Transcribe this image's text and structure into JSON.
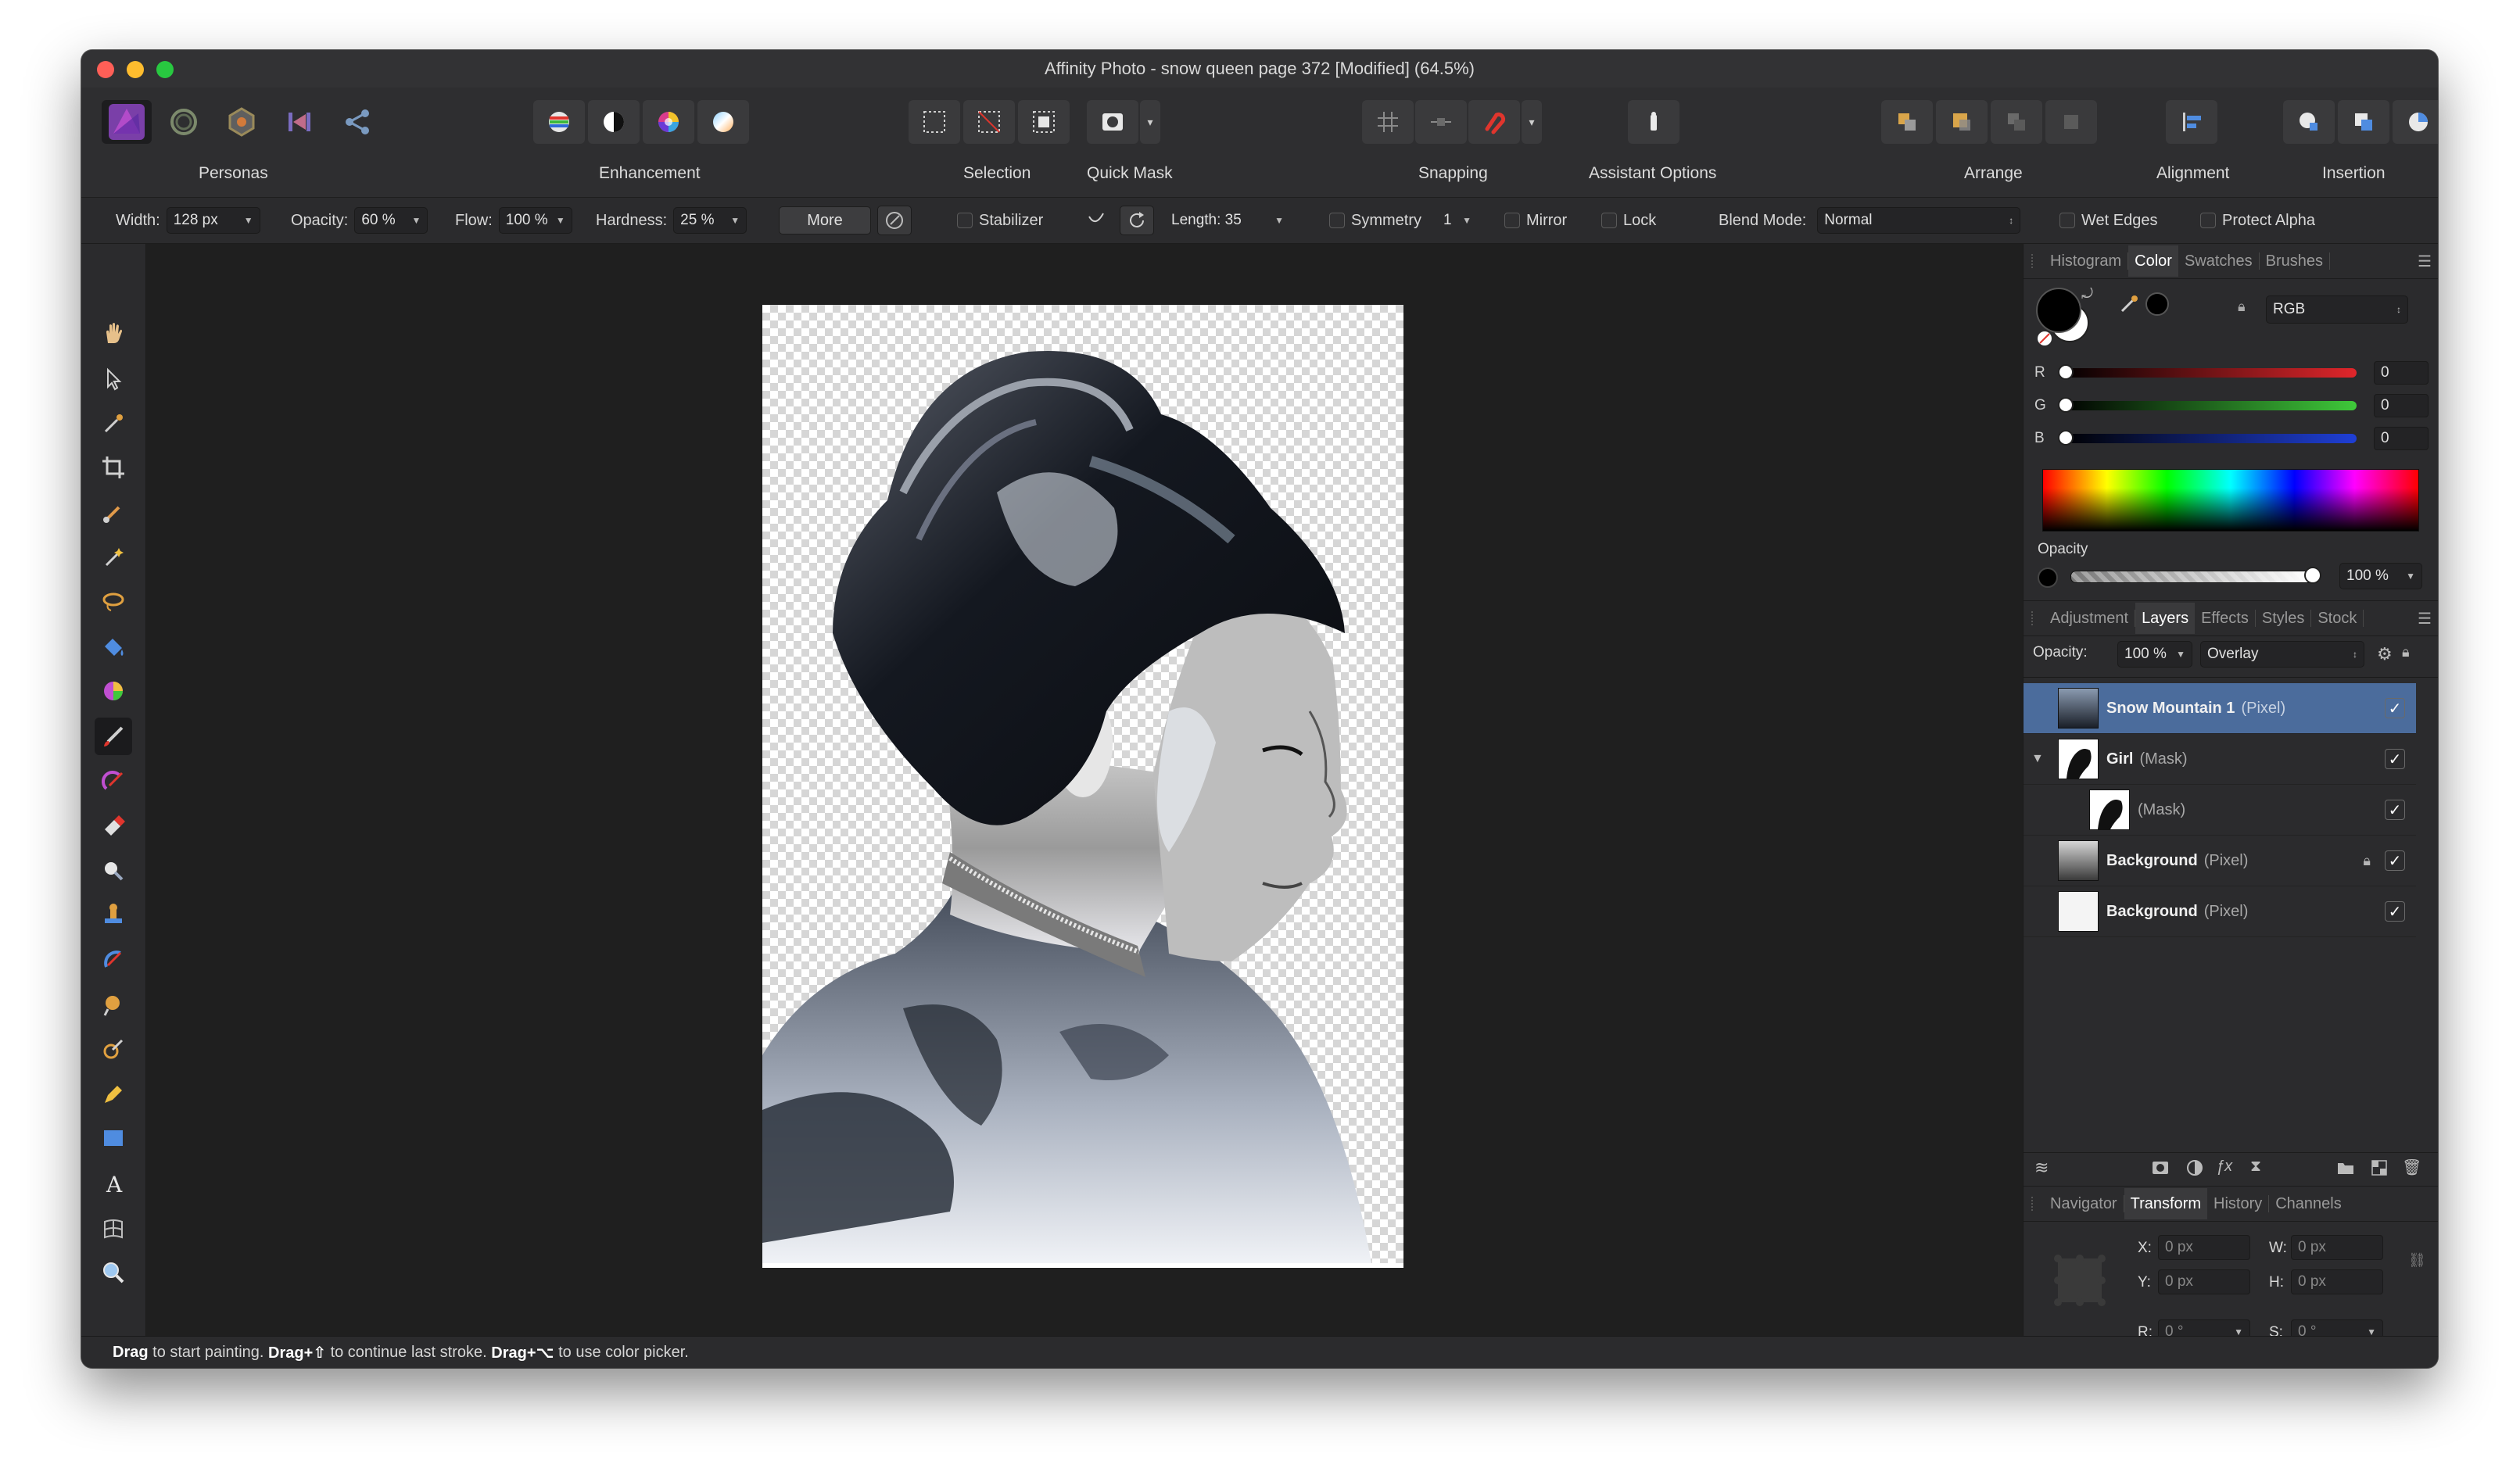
{
  "window": {
    "title": "Affinity Photo - snow queen page 372 [Modified] (64.5%)"
  },
  "toolbar": {
    "personas_label": "Personas",
    "enhancement_label": "Enhancement",
    "selection_label": "Selection",
    "quickmask_label": "Quick Mask",
    "snapping_label": "Snapping",
    "assistant_label": "Assistant Options",
    "arrange_label": "Arrange",
    "alignment_label": "Alignment",
    "insertion_label": "Insertion"
  },
  "context": {
    "width_label": "Width:",
    "width_value": "128 px",
    "opacity_label": "Opacity:",
    "opacity_value": "60 %",
    "flow_label": "Flow:",
    "flow_value": "100 %",
    "hardness_label": "Hardness:",
    "hardness_value": "25 %",
    "more_label": "More",
    "stabilizer_label": "Stabilizer",
    "length_label": "Length: 35",
    "symmetry_label": "Symmetry",
    "symmetry_value": "1",
    "mirror_label": "Mirror",
    "lock_label": "Lock",
    "blend_label": "Blend Mode:",
    "blend_value": "Normal",
    "wet_edges_label": "Wet Edges",
    "protect_alpha_label": "Protect Alpha"
  },
  "color_panel": {
    "tabs": [
      "Histogram",
      "Color",
      "Swatches",
      "Brushes"
    ],
    "active_tab": "Color",
    "mode": "RGB",
    "r_label": "R",
    "r_value": "0",
    "g_label": "G",
    "g_value": "0",
    "b_label": "B",
    "b_value": "0",
    "opacity_label": "Opacity",
    "opacity_value": "100 %",
    "colors": {
      "red": "#e0262b",
      "green": "#3fc93a",
      "blue": "#1f3fd6"
    }
  },
  "layers_panel": {
    "tabs": [
      "Adjustment",
      "Layers",
      "Effects",
      "Styles",
      "Stock"
    ],
    "active_tab": "Layers",
    "opacity_label": "Opacity:",
    "opacity_value": "100 %",
    "blend_value": "Overlay",
    "layers": [
      {
        "name": "Snow Mountain 1",
        "type": "(Pixel)",
        "selected": true
      },
      {
        "name": "Girl",
        "type": "(Mask)",
        "selected": false
      },
      {
        "name": "",
        "type": "(Mask)",
        "selected": false
      },
      {
        "name": "Background",
        "type": "(Pixel)",
        "selected": false
      },
      {
        "name": "Background",
        "type": "(Pixel)",
        "selected": false
      }
    ]
  },
  "transform_panel": {
    "tabs": [
      "Navigator",
      "Transform",
      "History",
      "Channels"
    ],
    "active_tab": "Transform",
    "x_label": "X:",
    "x_value": "0 px",
    "y_label": "Y:",
    "y_value": "0 px",
    "w_label": "W:",
    "w_value": "0 px",
    "h_label": "H:",
    "h_value": "0 px",
    "r_label": "R:",
    "r_value": "0 °",
    "s_label": "S:",
    "s_value": "0 °"
  },
  "status": {
    "b1": "Drag",
    "t1": " to start painting. ",
    "b2": "Drag+⇧",
    "t2": " to continue last stroke. ",
    "b3": "Drag+⌥",
    "t3": " to use color picker."
  }
}
